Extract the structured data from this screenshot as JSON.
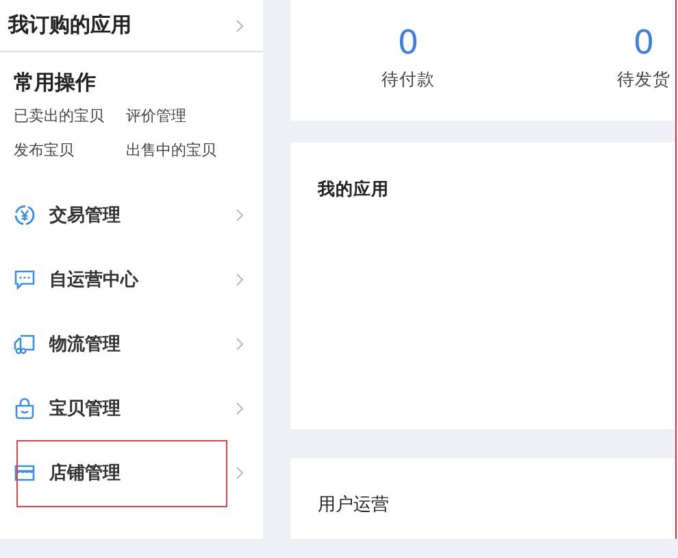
{
  "sidebar": {
    "header": {
      "label": "我订购的应用"
    },
    "shortcuts": {
      "title": "常用操作",
      "links": [
        "已卖出的宝贝",
        "评价管理",
        "发布宝贝",
        "出售中的宝贝"
      ]
    },
    "menu": [
      {
        "label": "交易管理",
        "kind": "yen",
        "highlighted": false
      },
      {
        "label": "自运营中心",
        "kind": "chat",
        "highlighted": false
      },
      {
        "label": "物流管理",
        "kind": "truck",
        "highlighted": false
      },
      {
        "label": "宝贝管理",
        "kind": "bag",
        "highlighted": false
      },
      {
        "label": "店铺管理",
        "kind": "store",
        "highlighted": true
      }
    ]
  },
  "stats": [
    {
      "value": "0",
      "label": "待付款"
    },
    {
      "value": "0",
      "label": "待发货"
    }
  ],
  "cards": [
    {
      "title": "我的应用",
      "kind": "tall"
    },
    {
      "title": "用户运营",
      "kind": "short"
    }
  ]
}
